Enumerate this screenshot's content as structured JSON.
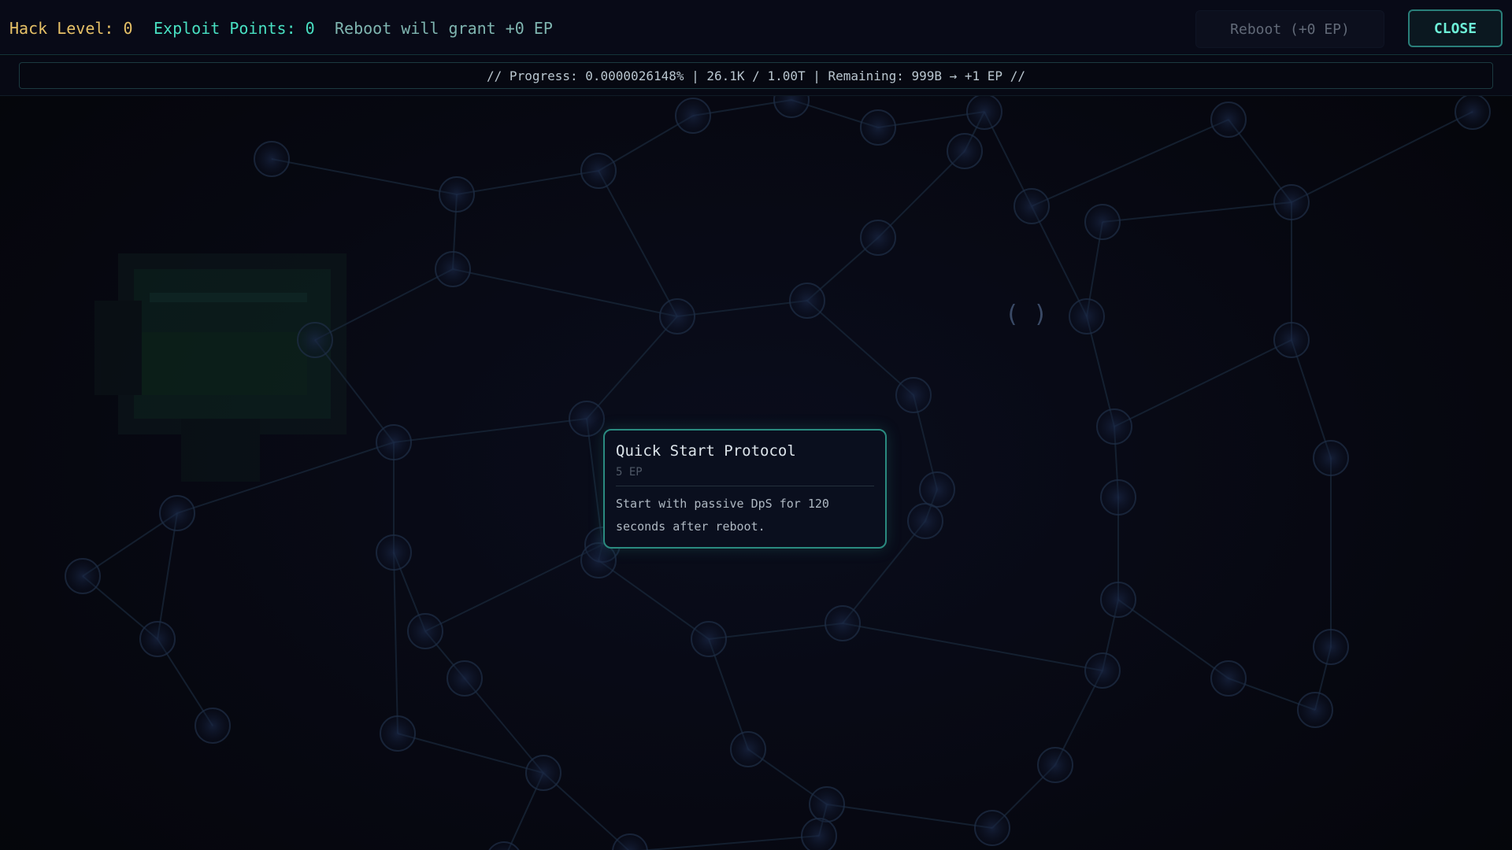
{
  "header": {
    "hack_level": "Hack Level: 0",
    "exploit_points": "Exploit Points: 0",
    "reboot_grant": "Reboot will grant +0 EP",
    "reboot_button": "Reboot (+0 EP)",
    "close_button": "CLOSE"
  },
  "progress": {
    "text": "// Progress: 0.0000026148% | 26.1K / 1.00T | Remaining: 999B → +1 EP //",
    "percent": 2.6148e-06
  },
  "tree": {
    "glyph": "( )"
  },
  "tooltip": {
    "title": "Quick Start Protocol",
    "cost": "5 EP",
    "description": "Start with passive DpS for 120 seconds after reboot."
  },
  "colors": {
    "accent": "#48e0c2",
    "gold": "#e6c167",
    "border": "#2a8a7f",
    "background": "#06070f"
  }
}
